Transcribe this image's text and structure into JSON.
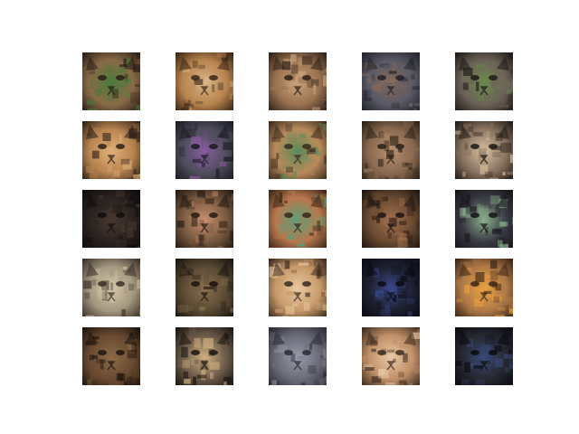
{
  "figure": {
    "rows": 5,
    "cols": 5,
    "background": "#ffffff",
    "description_kind": "grid of generated cat-face images"
  },
  "tiles": [
    {
      "base": "#8a6a48",
      "dark": "#2a1e16",
      "accent": "#4a7a3a"
    },
    {
      "base": "#b8844e",
      "dark": "#3a2416",
      "accent": "#d8b486"
    },
    {
      "base": "#9a7250",
      "dark": "#2e2018",
      "accent": "#c9a17a"
    },
    {
      "base": "#5a5a66",
      "dark": "#22222a",
      "accent": "#8a6a58"
    },
    {
      "base": "#6c6258",
      "dark": "#1e1a18",
      "accent": "#6b8a4a"
    },
    {
      "base": "#b88450",
      "dark": "#2e2016",
      "accent": "#e0b07a"
    },
    {
      "base": "#4e4e5c",
      "dark": "#1a1a22",
      "accent": "#8a5aa0"
    },
    {
      "base": "#b88a5a",
      "dark": "#3a2a1e",
      "accent": "#5a8a5a"
    },
    {
      "base": "#8a6a50",
      "dark": "#2a2016",
      "accent": "#b89070"
    },
    {
      "base": "#8a7460",
      "dark": "#1e1814",
      "accent": "#d8c0a0"
    },
    {
      "base": "#2a2220",
      "dark": "#100c0c",
      "accent": "#4a3a30"
    },
    {
      "base": "#7a5a40",
      "dark": "#241a12",
      "accent": "#c89070"
    },
    {
      "base": "#b8784e",
      "dark": "#3a2618",
      "accent": "#5aa07a"
    },
    {
      "base": "#6a4a30",
      "dark": "#1e1410",
      "accent": "#a07050"
    },
    {
      "base": "#3a3a44",
      "dark": "#141418",
      "accent": "#8ab08a"
    },
    {
      "base": "#a49880",
      "dark": "#3a3028",
      "accent": "#d8c8a8"
    },
    {
      "base": "#5a4a34",
      "dark": "#1a140e",
      "accent": "#8a7050"
    },
    {
      "base": "#c89a6a",
      "dark": "#3a2a1e",
      "accent": "#e8c8a0"
    },
    {
      "base": "#1e2030",
      "dark": "#0a0a12",
      "accent": "#3a4a8a"
    },
    {
      "base": "#b07a48",
      "dark": "#3a2416",
      "accent": "#e8a040"
    },
    {
      "base": "#6a4a30",
      "dark": "#1e140e",
      "accent": "#8a6a48"
    },
    {
      "base": "#6a5a48",
      "dark": "#1a1410",
      "accent": "#d0b080"
    },
    {
      "base": "#6a6a78",
      "dark": "#2a2a34",
      "accent": "#9a9aaa"
    },
    {
      "base": "#c09068",
      "dark": "#3a2a1e",
      "accent": "#e8c8a8"
    },
    {
      "base": "#262830",
      "dark": "#0a0a10",
      "accent": "#3a4a7a"
    }
  ]
}
